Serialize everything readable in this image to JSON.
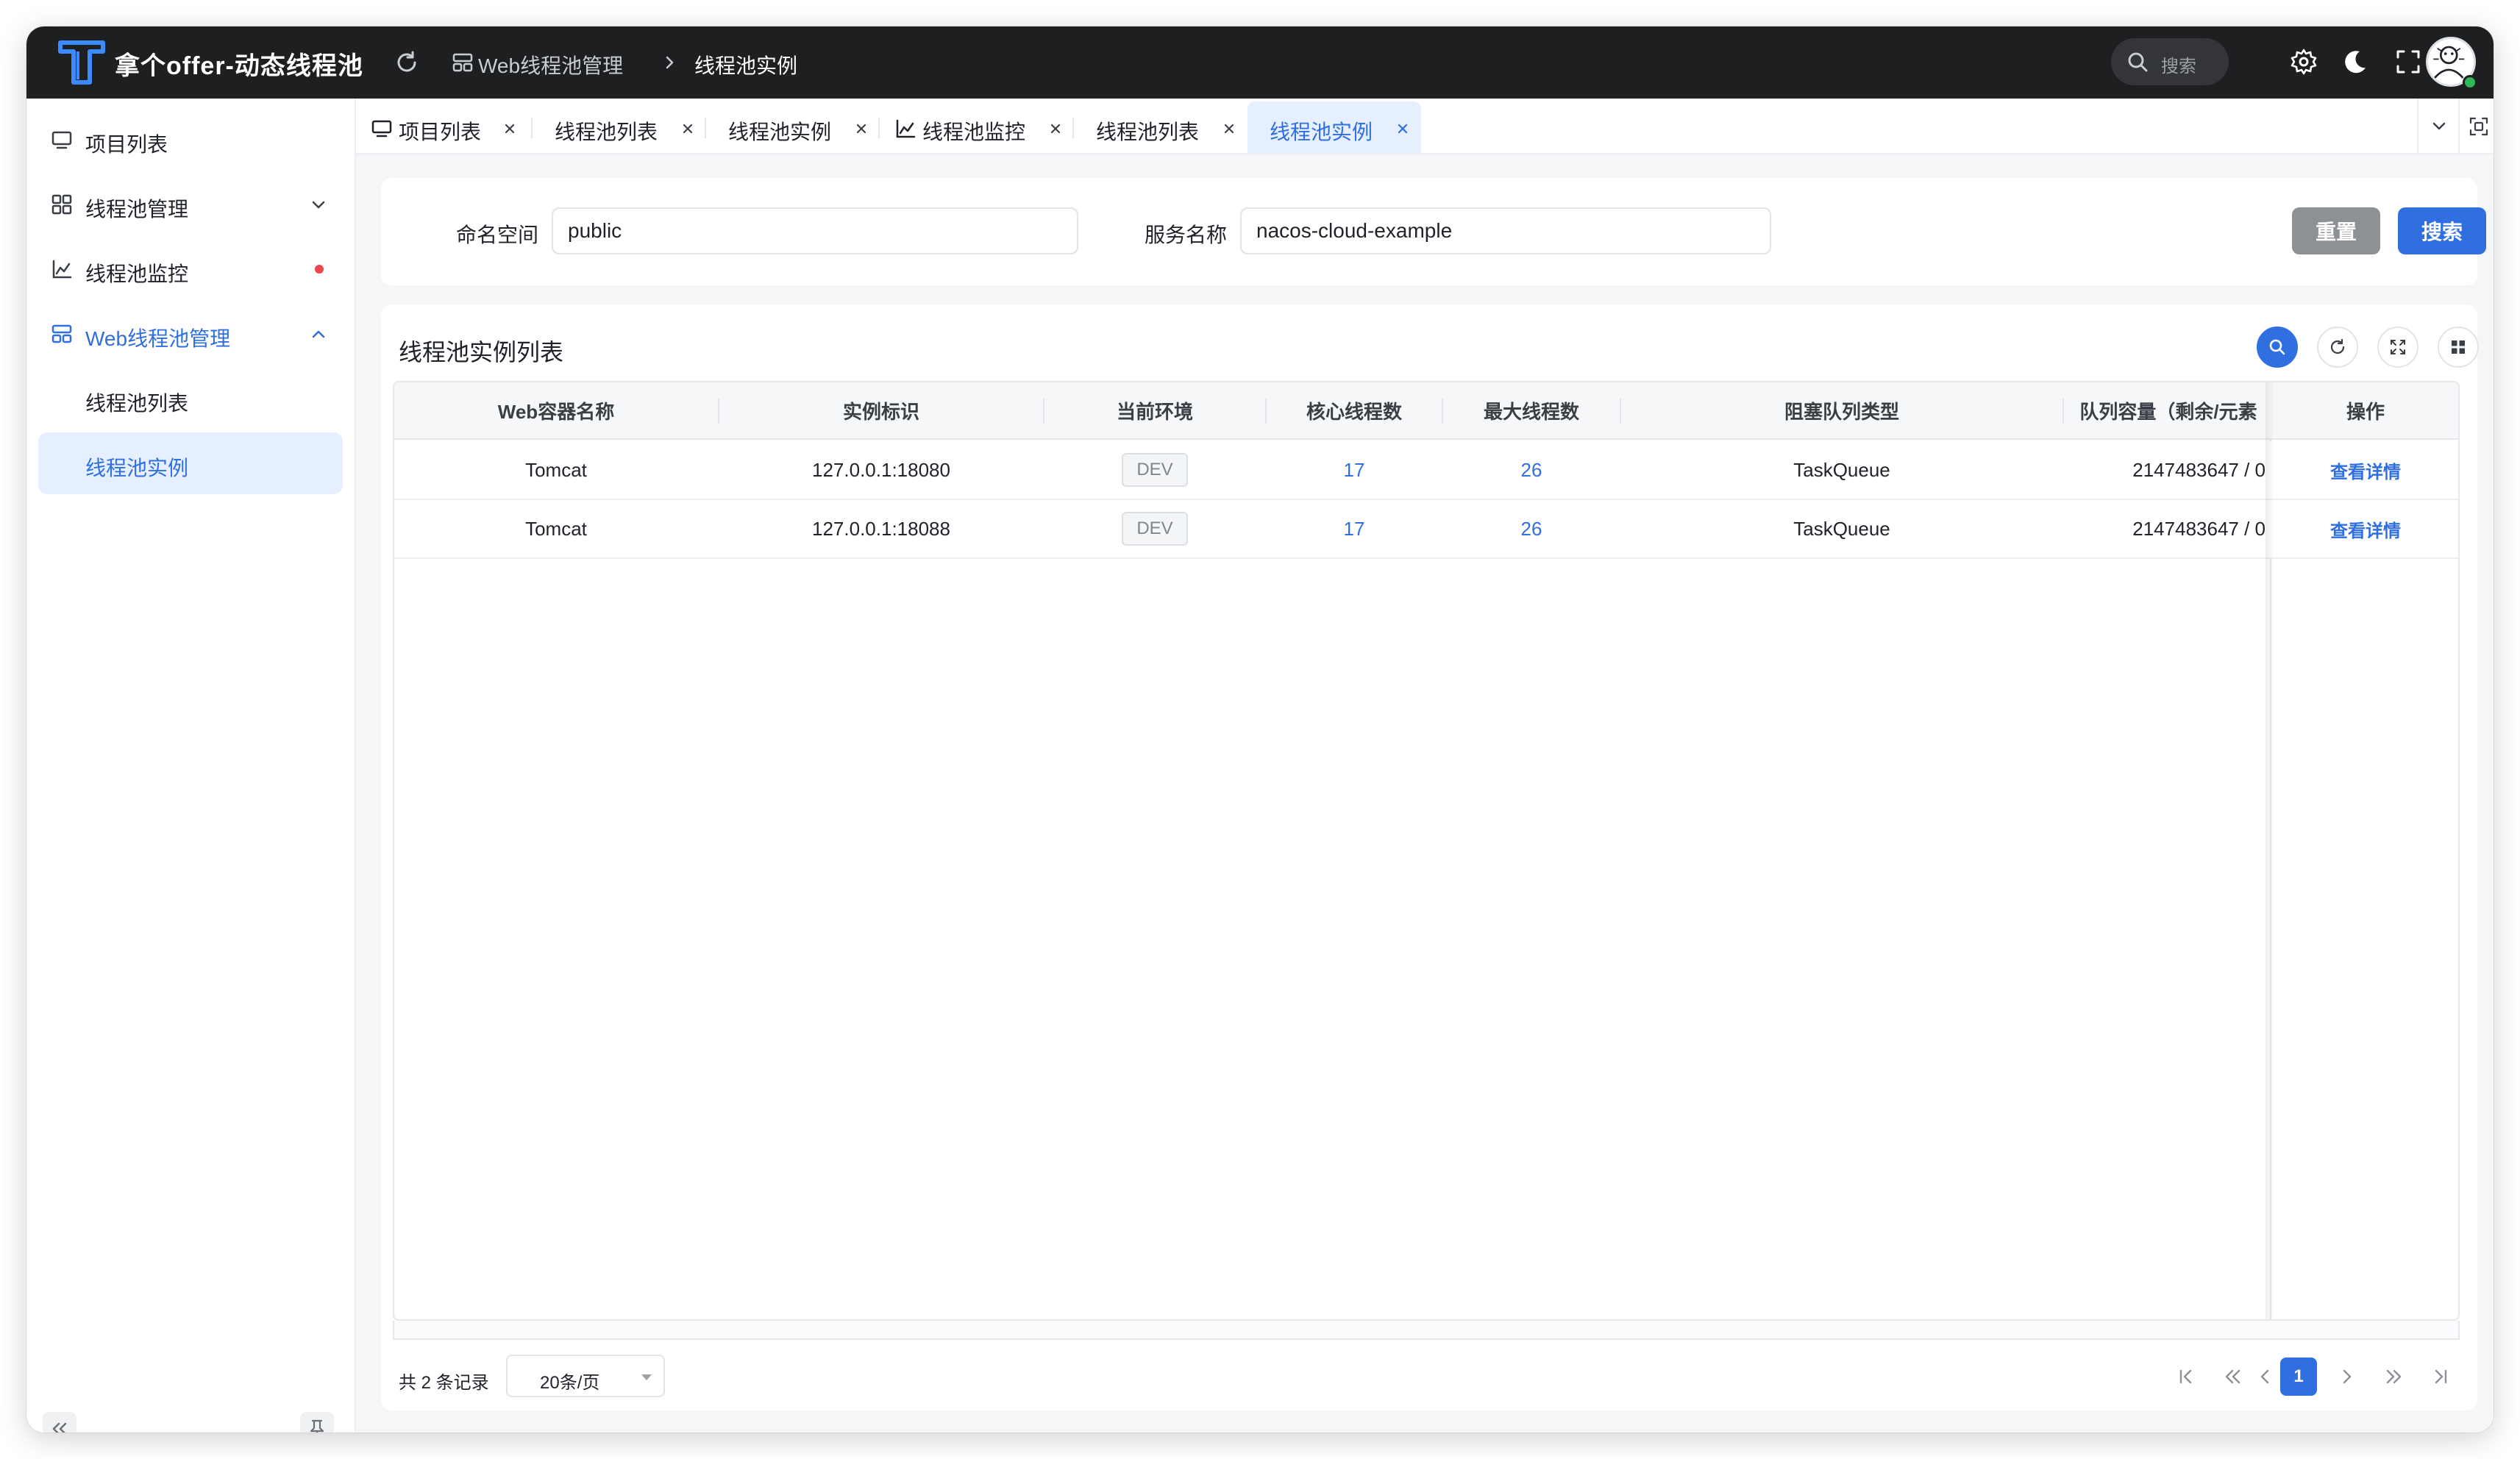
{
  "app": {
    "title": "拿个offer-动态线程池",
    "breadcrumb": [
      "Web线程池管理",
      "线程池实例"
    ]
  },
  "topbar": {
    "search_placeholder": "搜索"
  },
  "sidebar": {
    "items": [
      {
        "label": "项目列表"
      },
      {
        "label": "线程池管理"
      },
      {
        "label": "线程池监控"
      },
      {
        "label": "Web线程池管理"
      },
      {
        "label": "线程池列表"
      },
      {
        "label": "线程池实例"
      }
    ]
  },
  "tabs": [
    {
      "label": "项目列表"
    },
    {
      "label": "线程池列表"
    },
    {
      "label": "线程池实例"
    },
    {
      "label": "线程池监控"
    },
    {
      "label": "线程池列表"
    },
    {
      "label": "线程池实例"
    }
  ],
  "search_form": {
    "namespace_label": "命名空间",
    "namespace_value": "public",
    "service_label": "服务名称",
    "service_value": "nacos-cloud-example",
    "reset_label": "重置",
    "search_label": "搜索"
  },
  "list": {
    "title": "线程池实例列表",
    "columns": [
      "Web容器名称",
      "实例标识",
      "当前环境",
      "核心线程数",
      "最大线程数",
      "阻塞队列类型",
      "队列容量（剩余/元素",
      "操作"
    ],
    "rows": [
      {
        "container": "Tomcat",
        "instance": "127.0.0.1:18080",
        "env": "DEV",
        "core": "17",
        "max": "26",
        "queue_type": "TaskQueue",
        "capacity": "2147483647 / 0",
        "action": "查看详情"
      },
      {
        "container": "Tomcat",
        "instance": "127.0.0.1:18088",
        "env": "DEV",
        "core": "17",
        "max": "26",
        "queue_type": "TaskQueue",
        "capacity": "2147483647 / 0",
        "action": "查看详情"
      }
    ]
  },
  "pagination": {
    "total": "共 2 条记录",
    "page_size": "20条/页",
    "current_page": "1"
  },
  "colors": {
    "accent": "#2f6fe0",
    "topbar": "#1e1f21",
    "danger_dot": "#f0454c",
    "online": "#2fb956"
  }
}
